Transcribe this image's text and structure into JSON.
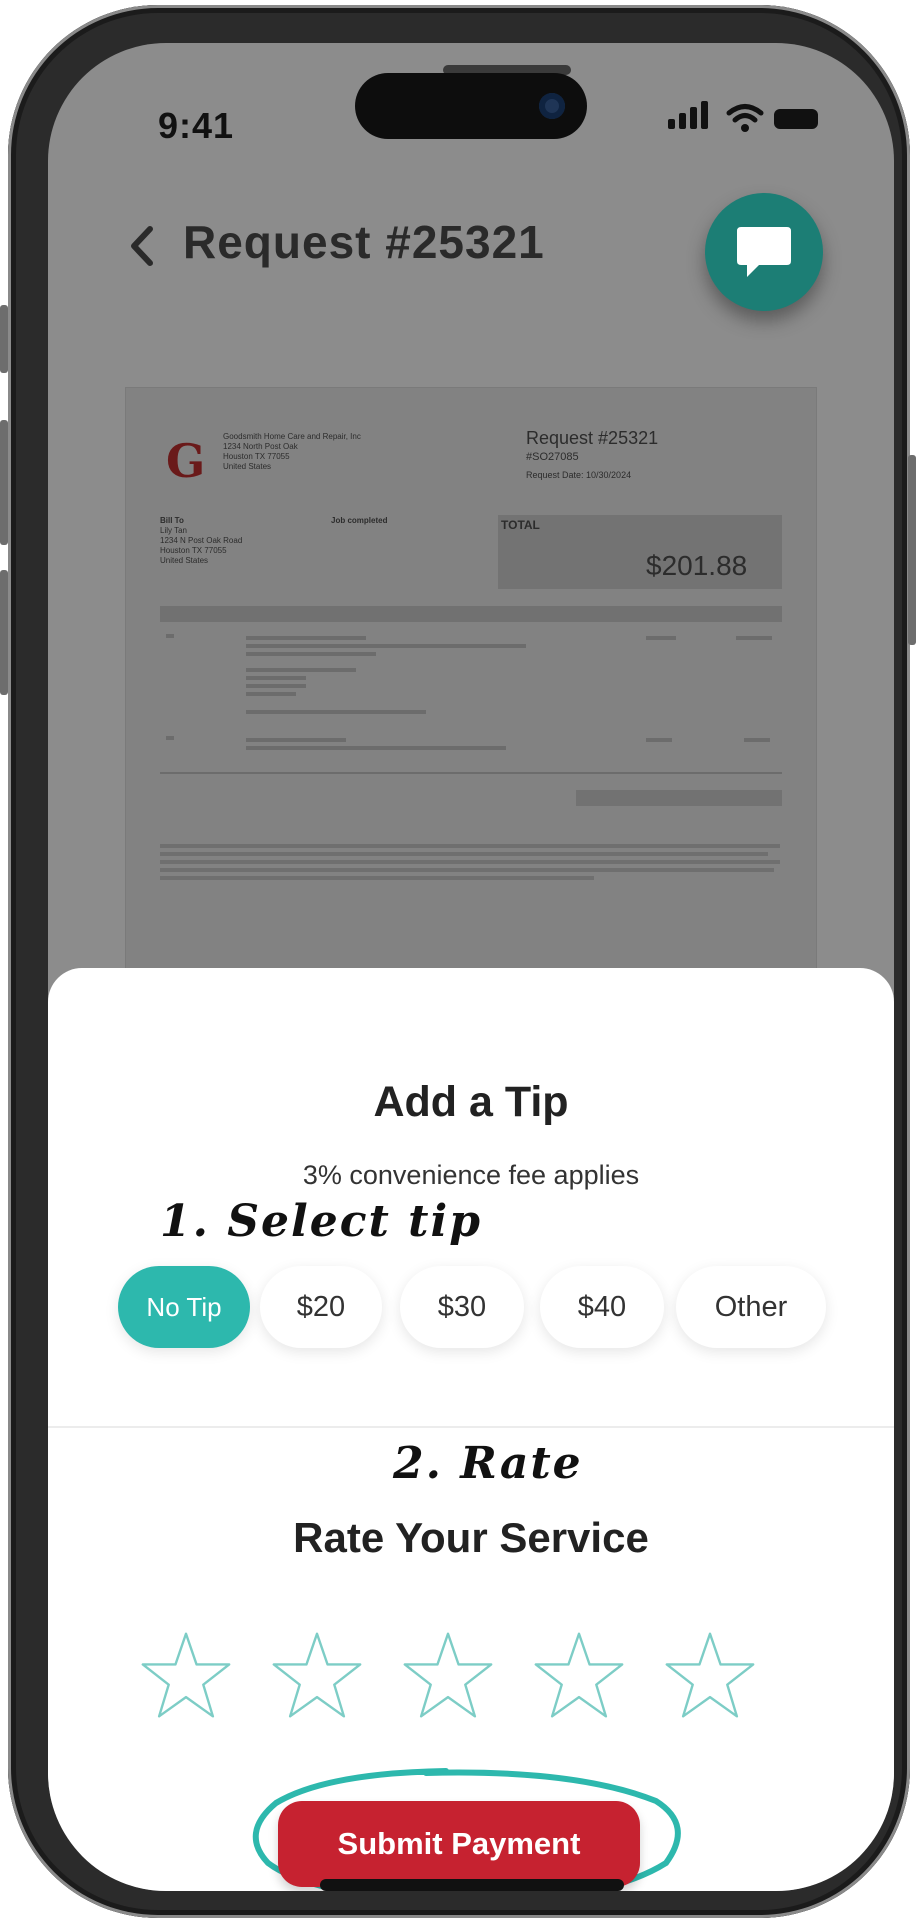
{
  "status_bar": {
    "time": "9:41"
  },
  "header": {
    "title": "Request #25321"
  },
  "invoice": {
    "company_lines": [
      "Goodsmith Home Care and Repair, Inc",
      "1234 North Post Oak",
      "Houston TX 77055",
      "United States"
    ],
    "request_title": "Request #25321",
    "order_id": "#SO27085",
    "request_date": "Request Date: 10/30/2024",
    "bill_to_lines": [
      "Bill To",
      "Lily Tan",
      "1234 N Post Oak Road",
      "Houston TX 77055",
      "United States"
    ],
    "job_completed_label": "Job completed",
    "total_label": "TOTAL",
    "total_amount": "$201.88"
  },
  "tip_sheet": {
    "title": "Add a Tip",
    "subtitle": "3% convenience fee applies",
    "annotation": "1. Select tip",
    "options": [
      {
        "label": "No Tip",
        "selected": true
      },
      {
        "label": "$20",
        "selected": false
      },
      {
        "label": "$30",
        "selected": false
      },
      {
        "label": "$40",
        "selected": false
      },
      {
        "label": "Other",
        "selected": false
      }
    ]
  },
  "rating": {
    "annotation": "2. Rate",
    "title": "Rate Your Service",
    "stars_total": 5,
    "stars_selected": 0
  },
  "submit": {
    "label": "Submit Payment"
  },
  "colors": {
    "accent": "#2db8ad",
    "submit": "#c62230",
    "chat": "#1c7e75"
  },
  "icons": {
    "back": "chevron-left-icon",
    "chat": "chat-bubble-icon",
    "star": "star-outline-icon"
  }
}
